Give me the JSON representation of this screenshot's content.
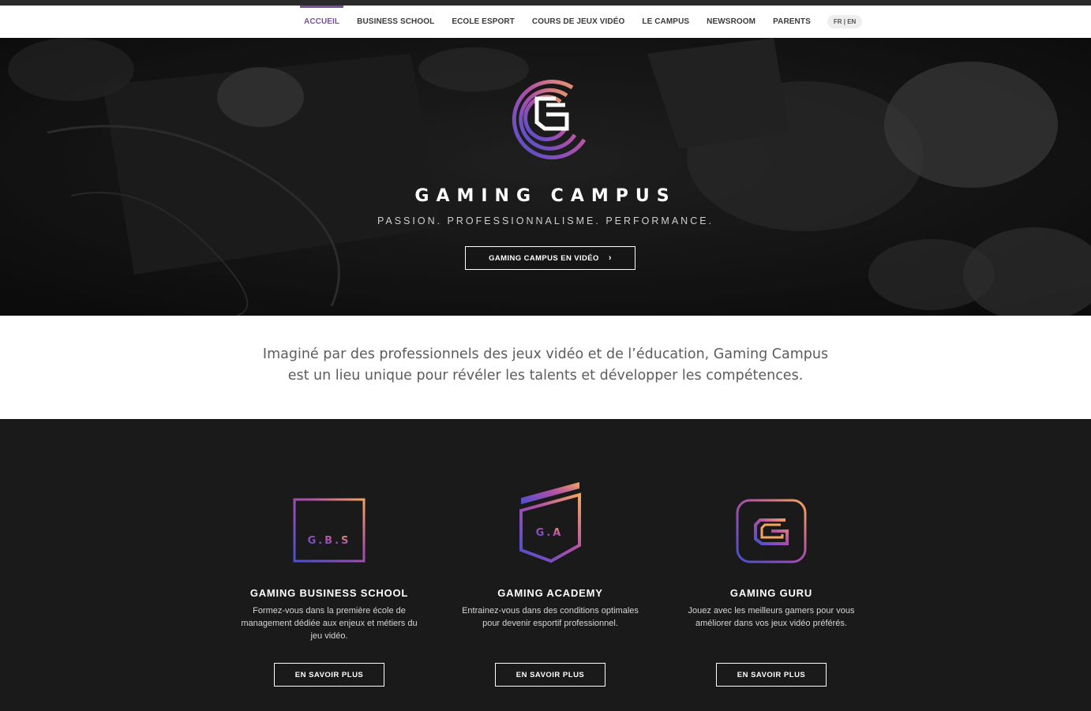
{
  "nav": {
    "items": [
      {
        "label": "ACCUEIL",
        "active": true
      },
      {
        "label": "BUSINESS SCHOOL",
        "active": false
      },
      {
        "label": "ECOLE ESPORT",
        "active": false
      },
      {
        "label": "COURS DE JEUX VIDÉO",
        "active": false
      },
      {
        "label": "LE CAMPUS",
        "active": false
      },
      {
        "label": "NEWSROOM",
        "active": false
      },
      {
        "label": "PARENTS",
        "active": false
      }
    ],
    "lang": "FR | EN"
  },
  "hero": {
    "logo_icon": "gaming-campus-g-logo",
    "title": "GAMING CAMPUS",
    "tagline": "PASSION. PROFESSIONNALISME. PERFORMANCE.",
    "button_label": "GAMING CAMPUS EN VIDÉO",
    "button_icon": "chevron-right-icon"
  },
  "intro": {
    "line1": "Imaginé par des professionnels des jeux vidéo et de l’éducation, Gaming Campus",
    "line2": "est un lieu unique pour révéler les talents et développer les compétences."
  },
  "programs": [
    {
      "logo_text": "G.B.S",
      "title": "GAMING BUSINESS SCHOOL",
      "description": "Formez-vous dans la première école de management dédiée aux enjeux et métiers du jeu vidéo.",
      "button_label": "EN SAVOIR PLUS"
    },
    {
      "logo_text": "G.A",
      "title": "GAMING ACADEMY",
      "description": "Entrainez-vous dans des conditions optimales pour devenir esportif professionnel.",
      "button_label": "EN SAVOIR PLUS"
    },
    {
      "logo_text": "G",
      "title": "GAMING GURU",
      "description": "Jouez avec les meilleurs gamers pour vous améliorer dans vos jeux vidéo préférés.",
      "button_label": "EN SAVOIR PLUS"
    }
  ],
  "colors": {
    "accent": "#7b4fa0",
    "gradient_start": "#5b4fc4",
    "gradient_mid": "#b04fa8",
    "gradient_end": "#f0a060",
    "dark_bg": "#1a1a1a"
  }
}
